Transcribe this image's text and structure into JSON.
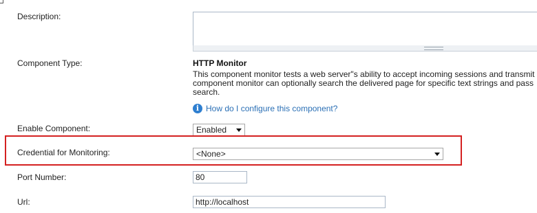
{
  "form": {
    "description_label": "Description:",
    "description_value": "",
    "component_type_label": "Component Type:",
    "component_type_title": "HTTP Monitor",
    "component_type_desc_lines": [
      "This component monitor tests a web server\"s ability to accept incoming sessions and transmit",
      "component monitor can optionally search the delivered page for specific text strings and pass",
      "search."
    ],
    "help_icon": "info-icon",
    "help_link": "How do I configure this component?",
    "enable_label": "Enable Component:",
    "enable_value": "Enabled",
    "credential_label": "Credential for Monitoring:",
    "credential_value": "<None>",
    "port_label": "Port Number:",
    "port_value": "80",
    "url_label": "Url:",
    "url_value": "http://localhost"
  },
  "colors": {
    "highlight": "#d42020",
    "link": "#2a6fb5",
    "info_icon": "#2f7fd0"
  }
}
